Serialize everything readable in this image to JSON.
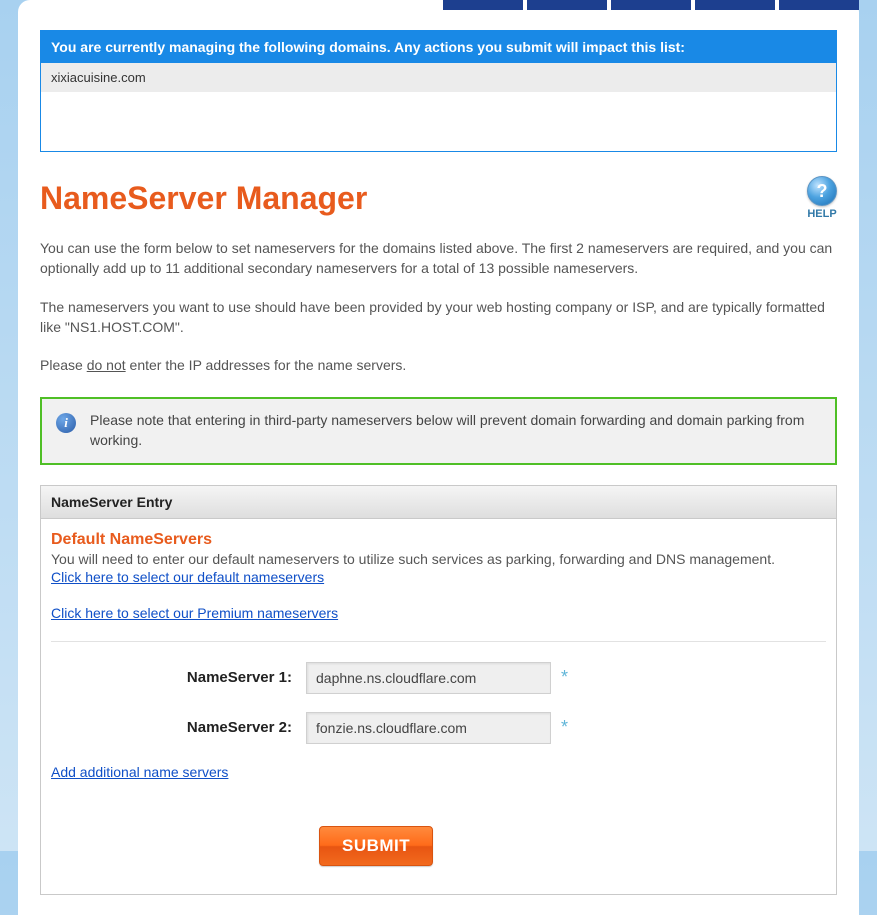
{
  "banner": {
    "header": "You are currently managing the following domains. Any actions you submit will impact this list:",
    "domain": "xixiacuisine.com"
  },
  "title": "NameServer Manager",
  "help": {
    "icon_char": "?",
    "label": "HELP"
  },
  "intro": {
    "p1": "You can use the form below to set nameservers for the domains listed above. The first 2 nameservers are required, and you can optionally add up to 11 additional secondary nameservers for a total of 13 possible nameservers.",
    "p2": "The nameservers you want to use should have been provided by your web hosting company or ISP, and are typically formatted like \"NS1.HOST.COM\".",
    "p3_prefix": "Please ",
    "p3_underlined": "do not",
    "p3_suffix": " enter the IP addresses for the name servers."
  },
  "notice": {
    "icon_char": "i",
    "text": "Please note that entering in third-party nameservers below will prevent domain forwarding and domain parking from working."
  },
  "entry": {
    "header": "NameServer Entry",
    "default_title": "Default NameServers",
    "default_desc": "You will need to enter our default nameservers to utilize such services as parking, forwarding and DNS management.",
    "default_link": "Click here to select our default nameservers",
    "premium_link": "Click here to select our Premium nameservers",
    "fields": [
      {
        "label": "NameServer 1:",
        "value": "daphne.ns.cloudflare.com",
        "required": true
      },
      {
        "label": "NameServer 2:",
        "value": "fonzie.ns.cloudflare.com",
        "required": true
      }
    ],
    "add_link": "Add additional name servers",
    "submit_label": "SUBMIT",
    "star": "*"
  }
}
